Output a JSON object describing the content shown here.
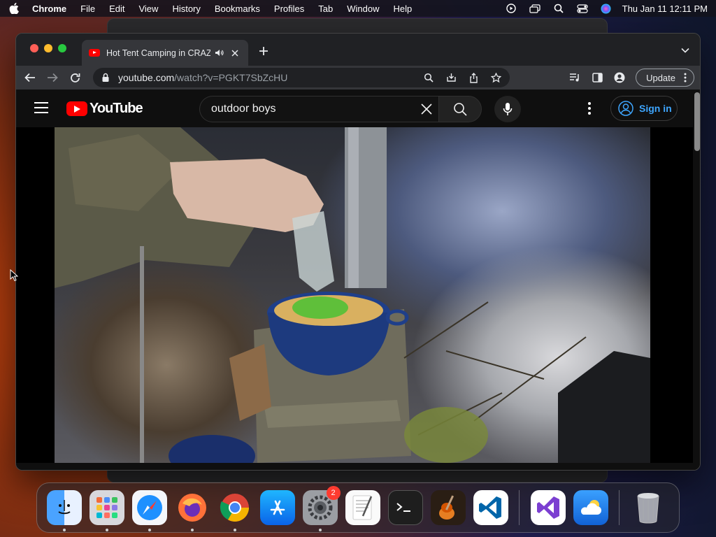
{
  "menubar": {
    "app_name": "Chrome",
    "menus": [
      "File",
      "Edit",
      "View",
      "History",
      "Bookmarks",
      "Profiles",
      "Tab",
      "Window",
      "Help"
    ],
    "clock": "Thu Jan 11  12:11 PM",
    "status_icons": [
      "play-circle-icon",
      "screen-mirror-icon",
      "spotlight-search-icon",
      "control-center-icon",
      "siri-icon"
    ]
  },
  "browser": {
    "tab": {
      "title": "Hot Tent Camping in CRAZ",
      "favicon": "youtube-favicon-icon",
      "audio": "audio-playing-icon"
    },
    "address": {
      "host": "youtube.com",
      "path": "/watch?v=PGKT7SbZcHU"
    },
    "update_label": "Update"
  },
  "youtube": {
    "logo_text": "YouTube",
    "search_value": "outdoor boys",
    "signin_label": "Sign in"
  },
  "dock": {
    "apps": [
      {
        "name": "Finder",
        "icon": "finder-icon",
        "running": true
      },
      {
        "name": "Launchpad",
        "icon": "launchpad-icon",
        "running": true
      },
      {
        "name": "Safari",
        "icon": "safari-icon",
        "running": true
      },
      {
        "name": "Firefox",
        "icon": "firefox-icon",
        "running": true
      },
      {
        "name": "Chrome",
        "icon": "chrome-icon",
        "running": true
      },
      {
        "name": "App Store",
        "icon": "app-store-icon",
        "running": false
      },
      {
        "name": "System Settings",
        "icon": "system-settings-icon",
        "running": true,
        "badge": "2"
      },
      {
        "name": "TextEdit",
        "icon": "textedit-icon",
        "running": false
      },
      {
        "name": "Terminal",
        "icon": "terminal-icon",
        "running": false
      },
      {
        "name": "GarageBand",
        "icon": "garageband-icon",
        "running": false
      },
      {
        "name": "VS Code",
        "icon": "vscode-icon",
        "running": false
      },
      {
        "name": "Visual Studio",
        "icon": "visual-studio-icon",
        "running": false
      },
      {
        "name": "Weather",
        "icon": "weather-icon",
        "running": false
      },
      {
        "name": "Trash",
        "icon": "trash-icon",
        "running": false
      }
    ]
  },
  "colors": {
    "youtube_red": "#ff0000",
    "signin_blue": "#3ea6ff",
    "chrome_dark": "#202124"
  }
}
